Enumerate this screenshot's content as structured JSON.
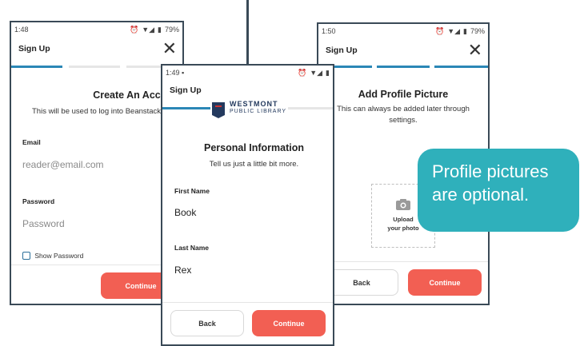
{
  "screen1": {
    "status_time": "1:48",
    "battery": "79%",
    "title": "Sign Up",
    "heading": "Create An Account",
    "subtitle": "This will be used to log into Beanstack.",
    "email_label": "Email",
    "email_placeholder": "reader@email.com",
    "password_label": "Password",
    "password_placeholder": "Password",
    "show_password": "Show Password",
    "continue": "Continue"
  },
  "screen2": {
    "status_time": "1:49",
    "title": "Sign Up",
    "logo_top": "WESTMONT",
    "logo_bottom": "PUBLIC LIBRARY",
    "heading": "Personal Information",
    "subtitle": "Tell us just a little bit more.",
    "first_name_label": "First Name",
    "first_name_value": "Book",
    "last_name_label": "Last Name",
    "last_name_value": "Rex",
    "back": "Back",
    "continue": "Continue"
  },
  "screen3": {
    "status_time": "1:50",
    "battery": "79%",
    "title": "Sign Up",
    "heading": "Add Profile Picture",
    "subtitle": "This can always be added later through settings.",
    "upload_line1": "Upload",
    "upload_line2": "your photo",
    "back": "Back",
    "continue": "Continue"
  },
  "callout": {
    "line1": "Profile pictures",
    "line2": "are optional."
  },
  "colors": {
    "accent": "#2b87b6",
    "button": "#f25f53",
    "callout": "#2fb0bb",
    "frame": "#3a4a57"
  }
}
